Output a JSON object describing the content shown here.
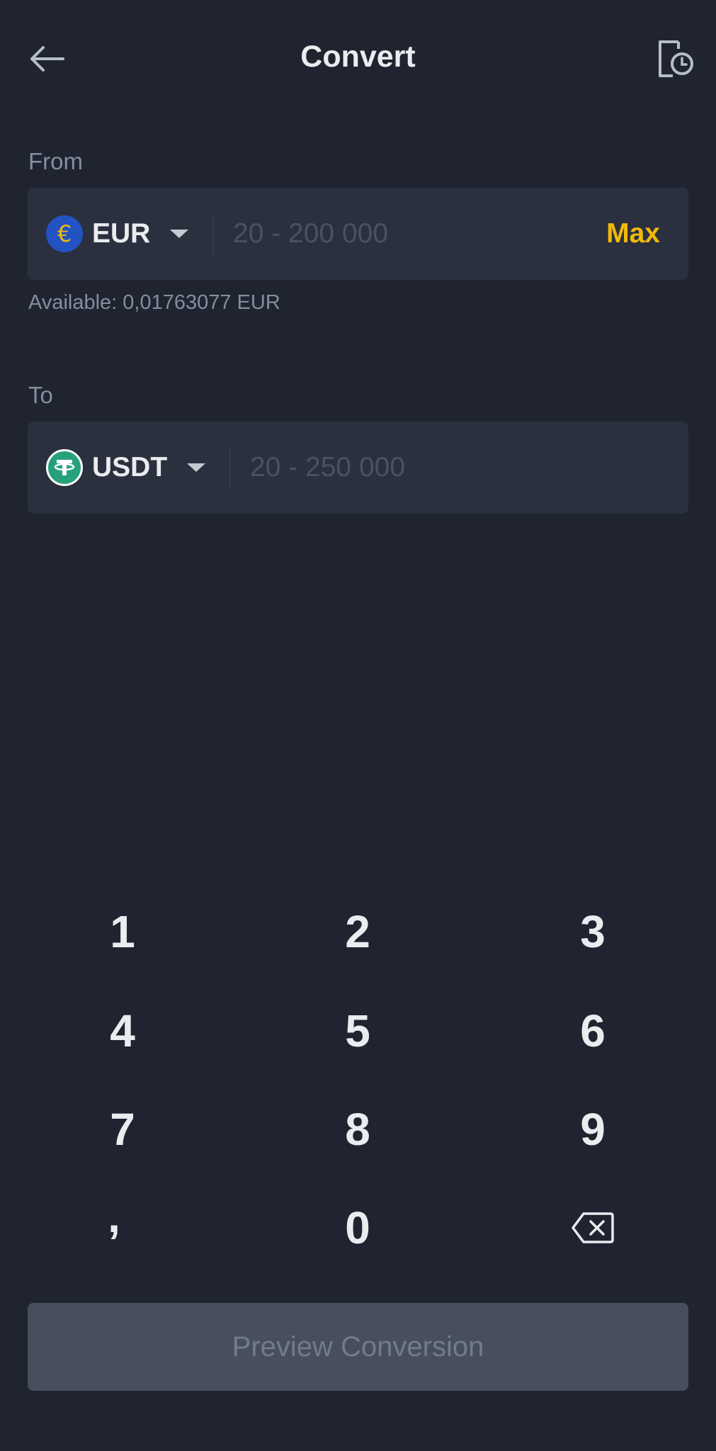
{
  "header": {
    "title": "Convert",
    "back_icon": "back-arrow-icon",
    "history_icon": "history-icon"
  },
  "from": {
    "label": "From",
    "coin": "EUR",
    "coin_symbol": "€",
    "coin_color": "#2352c3",
    "placeholder": "20 - 200 000",
    "max_label": "Max",
    "available": "Available: 0,01763077 EUR"
  },
  "to": {
    "label": "To",
    "coin": "USDT",
    "coin_color": "#26a17b",
    "placeholder": "20 - 250 000"
  },
  "keypad": {
    "keys": [
      "1",
      "2",
      "3",
      "4",
      "5",
      "6",
      "7",
      "8",
      "9",
      ",",
      "0"
    ],
    "backspace_icon": "backspace-icon"
  },
  "preview_button": "Preview Conversion",
  "colors": {
    "background": "#1f2430",
    "field": "#2a303d",
    "accent": "#f0b90b",
    "muted": "#848e9c"
  }
}
